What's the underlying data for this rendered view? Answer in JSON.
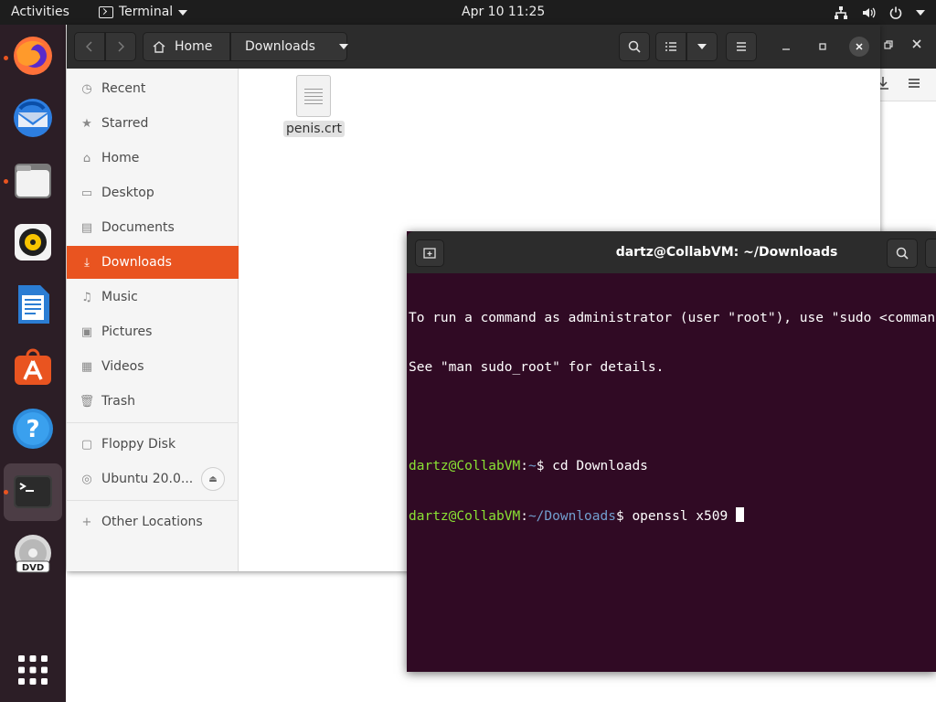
{
  "topbar": {
    "activities": "Activities",
    "app_name": "Terminal",
    "clock": "Apr 10  11:25"
  },
  "dock": {
    "apps": [
      "firefox",
      "thunderbird",
      "files",
      "rhythmbox",
      "libreoffice-writer",
      "ubuntu-software",
      "help",
      "terminal",
      "dvd"
    ],
    "running": [
      "firefox",
      "files",
      "terminal"
    ],
    "active": "terminal",
    "colors": {
      "accent": "#e95420",
      "dock_bg": "#2c1e26"
    }
  },
  "files": {
    "breadcrumb": {
      "home": "Home",
      "current": "Downloads"
    },
    "sidebar": {
      "items": [
        {
          "label": "Recent",
          "icon": "clock-icon"
        },
        {
          "label": "Starred",
          "icon": "star-icon"
        },
        {
          "label": "Home",
          "icon": "home-icon"
        },
        {
          "label": "Desktop",
          "icon": "desktop-icon"
        },
        {
          "label": "Documents",
          "icon": "document-icon"
        },
        {
          "label": "Downloads",
          "icon": "download-icon",
          "active": true
        },
        {
          "label": "Music",
          "icon": "music-icon"
        },
        {
          "label": "Pictures",
          "icon": "picture-icon"
        },
        {
          "label": "Videos",
          "icon": "video-icon"
        },
        {
          "label": "Trash",
          "icon": "trash-icon"
        }
      ],
      "devices": [
        {
          "label": "Floppy Disk",
          "icon": "floppy-icon"
        },
        {
          "label": "Ubuntu 20.0...",
          "icon": "disc-icon",
          "ejectable": true
        }
      ],
      "other": {
        "label": "Other Locations",
        "icon": "plus-icon"
      }
    },
    "content": {
      "files": [
        {
          "name": "penis.crt",
          "icon": "text-file-icon"
        }
      ]
    }
  },
  "terminal": {
    "title": "dartz@CollabVM: ~/Downloads",
    "lines": [
      {
        "text": "To run a command as administrator (user \"root\"), use \"sudo <command>\"."
      },
      {
        "text": "See \"man sudo_root\" for details."
      },
      {
        "text": ""
      },
      {
        "user": "dartz@CollabVM",
        "sep": ":",
        "path": "~",
        "dollar": "$ ",
        "cmd": "cd Downloads"
      },
      {
        "user": "dartz@CollabVM",
        "sep": ":",
        "path": "~/Downloads",
        "dollar": "$ ",
        "cmd": "openssl x509 "
      }
    ],
    "colors": {
      "background": "#300a24",
      "prompt_user": "#8ae234",
      "prompt_path": "#729fcf"
    }
  }
}
